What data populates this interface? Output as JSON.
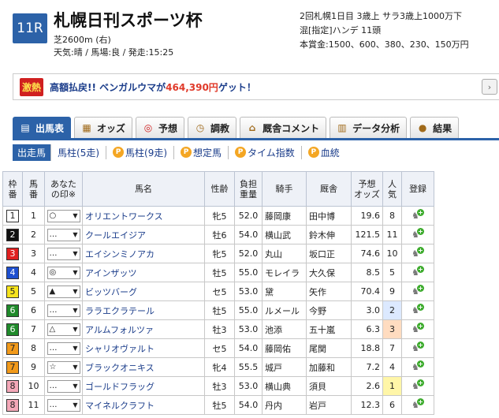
{
  "race": {
    "number": "11R",
    "title": "札幌日刊スポーツ杯",
    "course": "芝2600m (右)",
    "conditions": "天気:晴 / 馬場:良 / 発走:15:25",
    "info_lines": [
      "2回札幌1日目 3歳上 サラ3歳上1000万下",
      "混[指定]ハンデ 11頭",
      "本賞金:1500、600、380、230、150万円"
    ]
  },
  "banner": {
    "badge": "激熱",
    "text": "高額払戻!! ベンガルウマが",
    "amount": "464,390円",
    "suffix": "ゲット！",
    "next_icon": "chevron-right-icon"
  },
  "tabs": [
    {
      "label": "出馬表",
      "icon": "card-icon",
      "symbol": "▤"
    },
    {
      "label": "オッズ",
      "icon": "odds-board-icon",
      "symbol": "▦"
    },
    {
      "label": "予想",
      "icon": "target-icon",
      "symbol": "◎"
    },
    {
      "label": "調教",
      "icon": "stopwatch-icon",
      "symbol": "◷"
    },
    {
      "label": "厩舎コメント",
      "icon": "stable-icon",
      "symbol": "⌂"
    },
    {
      "label": "データ分析",
      "icon": "bar-chart-icon",
      "symbol": "▥"
    },
    {
      "label": "結果",
      "icon": "coins-icon",
      "symbol": "●"
    }
  ],
  "subnav": [
    {
      "label": "出走馬",
      "p": false
    },
    {
      "label": "馬柱(5走)",
      "p": false
    },
    {
      "label": "馬柱(9走)",
      "p": true
    },
    {
      "label": "想定馬",
      "p": true
    },
    {
      "label": "タイム指数",
      "p": true
    },
    {
      "label": "血統",
      "p": true
    }
  ],
  "p_icon": "P",
  "headers": {
    "waku": "枠\n番",
    "umaban": "馬\n番",
    "mark": "あなた\nの印※",
    "name": "馬名",
    "sexage": "性齢",
    "weight": "負担\n重量",
    "jockey": "騎手",
    "stable": "厩舎",
    "odds": "予想\nオッズ",
    "pop": "人\n気",
    "reg": "登録"
  },
  "colors": {
    "accent": "#2c62a8"
  },
  "horses": [
    {
      "waku": "1",
      "umaban": "1",
      "mark": "○",
      "name": "オリエントワークス",
      "sexage": "牝5",
      "weight": "52.0",
      "jockey": "藤岡康",
      "stable": "田中博",
      "odds": "19.6",
      "pop": "8"
    },
    {
      "waku": "2",
      "umaban": "2",
      "mark": "…",
      "name": "クールエイジア",
      "sexage": "牡6",
      "weight": "54.0",
      "jockey": "横山武",
      "stable": "鈴木伸",
      "odds": "121.5",
      "pop": "11"
    },
    {
      "waku": "3",
      "umaban": "3",
      "mark": "…",
      "name": "エイシンミノアカ",
      "sexage": "牝5",
      "weight": "52.0",
      "jockey": "丸山",
      "stable": "坂口正",
      "odds": "74.6",
      "pop": "10"
    },
    {
      "waku": "4",
      "umaban": "4",
      "mark": "◎",
      "name": "アインザッツ",
      "sexage": "牡5",
      "weight": "55.0",
      "jockey": "モレイラ",
      "stable": "大久保",
      "odds": "8.5",
      "pop": "5"
    },
    {
      "waku": "5",
      "umaban": "5",
      "mark": "▲",
      "name": "ビッツバーグ",
      "sexage": "セ5",
      "weight": "53.0",
      "jockey": "黛",
      "stable": "矢作",
      "odds": "70.4",
      "pop": "9"
    },
    {
      "waku": "6",
      "umaban": "6",
      "mark": "…",
      "name": "ララエクラテール",
      "sexage": "牡5",
      "weight": "55.0",
      "jockey": "ルメール",
      "stable": "今野",
      "odds": "3.0",
      "pop": "2"
    },
    {
      "waku": "6",
      "umaban": "7",
      "mark": "△",
      "name": "アルムフォルツァ",
      "sexage": "牡3",
      "weight": "53.0",
      "jockey": "池添",
      "stable": "五十嵐",
      "odds": "6.3",
      "pop": "3"
    },
    {
      "waku": "7",
      "umaban": "8",
      "mark": "…",
      "name": "シャリオヴァルト",
      "sexage": "セ5",
      "weight": "54.0",
      "jockey": "藤岡佑",
      "stable": "尾関",
      "odds": "18.8",
      "pop": "7"
    },
    {
      "waku": "7",
      "umaban": "9",
      "mark": "☆",
      "name": "ブラックオニキス",
      "sexage": "牝4",
      "weight": "55.5",
      "jockey": "城戸",
      "stable": "加藤和",
      "odds": "7.2",
      "pop": "4"
    },
    {
      "waku": "8",
      "umaban": "10",
      "mark": "…",
      "name": "ゴールドフラッグ",
      "sexage": "牡3",
      "weight": "53.0",
      "jockey": "横山典",
      "stable": "須貝",
      "odds": "2.6",
      "pop": "1"
    },
    {
      "waku": "8",
      "umaban": "11",
      "mark": "…",
      "name": "マイネルクラフト",
      "sexage": "牡5",
      "weight": "54.0",
      "jockey": "丹内",
      "stable": "岩戸",
      "odds": "12.3",
      "pop": "6"
    }
  ]
}
